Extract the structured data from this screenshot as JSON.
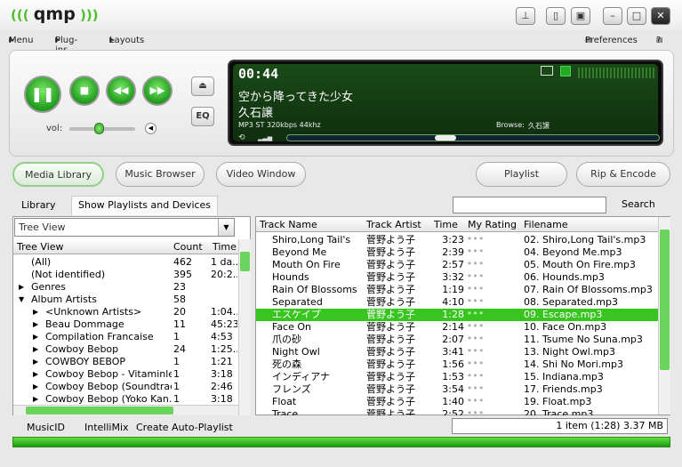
{
  "app": {
    "logo_text": "qmp"
  },
  "menu": {
    "menu": "Menu",
    "plugins": "Plug-ins",
    "layouts": "Layouts",
    "preferences": "Preferences",
    "help": "?"
  },
  "player": {
    "time": "00:44",
    "title": "空から降ってきた少女",
    "artist": "久石譲",
    "format": "MP3 ST 320kbps 44khz",
    "browse_label": "Browse:",
    "browse_value": "久石譲",
    "vol_label": "vol:",
    "eq_label": "EQ",
    "progress": 0.42,
    "volume": 0.45
  },
  "nav": {
    "media_library": "Media Library",
    "music_browser": "Music Browser",
    "video_window": "Video Window",
    "playlist": "Playlist",
    "rip_encode": "Rip & Encode"
  },
  "tabs": {
    "library": "Library",
    "show_playlists": "Show Playlists and Devices",
    "search_button": "Search",
    "search_value": ""
  },
  "tree": {
    "view_select": "Tree View",
    "headers": {
      "name": "Tree View",
      "count": "Count",
      "time": "Time"
    },
    "rows": [
      {
        "name": "(All)",
        "count": "462",
        "time": "1 da..."
      },
      {
        "name": "(Not identified)",
        "count": "395",
        "time": "20:2..."
      },
      {
        "name": "Genres",
        "count": "23",
        "time": ""
      },
      {
        "name": "Album Artists",
        "count": "58",
        "time": ""
      },
      {
        "name": "<Unknown Artists>",
        "count": "20",
        "time": "1:04..."
      },
      {
        "name": "Beau Dommage",
        "count": "11",
        "time": "45:23"
      },
      {
        "name": "Compilation Francaise",
        "count": "1",
        "time": "4:53"
      },
      {
        "name": "Cowboy Bebop",
        "count": "24",
        "time": "1:25..."
      },
      {
        "name": "COWBOY BEBOP",
        "count": "1",
        "time": "1:21"
      },
      {
        "name": "Cowboy Bebop - Vitaminless",
        "count": "1",
        "time": "3:18"
      },
      {
        "name": "Cowboy Bebop (Soundtrack)",
        "count": "1",
        "time": "2:46"
      },
      {
        "name": "Cowboy Bebop (Yoko Kan...",
        "count": "1",
        "time": "3:18"
      }
    ]
  },
  "tracks": {
    "headers": {
      "name": "Track Name",
      "artist": "Track Artist",
      "time": "Time",
      "rating": "My Rating",
      "file": "Filename"
    },
    "rows": [
      {
        "name": "Shiro,Long Tail's",
        "artist": "菅野よう子",
        "time": "3:23",
        "rating": "* * *",
        "file": "02. Shiro,Long Tail's.mp3"
      },
      {
        "name": "Beyond Me",
        "artist": "菅野よう子",
        "time": "2:39",
        "rating": "* * *",
        "file": "04. Beyond Me.mp3"
      },
      {
        "name": "Mouth On Fire",
        "artist": "菅野よう子",
        "time": "2:57",
        "rating": "* * *",
        "file": "05. Mouth On Fire.mp3"
      },
      {
        "name": "Hounds",
        "artist": "菅野よう子",
        "time": "3:32",
        "rating": "* * *",
        "file": "06. Hounds.mp3"
      },
      {
        "name": "Rain Of Blossoms",
        "artist": "菅野よう子",
        "time": "1:19",
        "rating": "* * *",
        "file": "07. Rain Of Blossoms.mp3"
      },
      {
        "name": "Separated",
        "artist": "菅野よう子",
        "time": "4:10",
        "rating": "* * *",
        "file": "08. Separated.mp3"
      },
      {
        "name": "エスケイプ",
        "artist": "菅野よう子",
        "time": "1:28",
        "rating": "* * *",
        "file": "09. Escape.mp3"
      },
      {
        "name": "Face On",
        "artist": "菅野よう子",
        "time": "2:14",
        "rating": "* * *",
        "file": "10. Face On.mp3"
      },
      {
        "name": "爪の砂",
        "artist": "菅野よう子",
        "time": "2:07",
        "rating": "* * *",
        "file": "11. Tsume No Suna.mp3"
      },
      {
        "name": "Night Owl",
        "artist": "菅野よう子",
        "time": "3:41",
        "rating": "* * *",
        "file": "13. Night Owl.mp3"
      },
      {
        "name": "死の森",
        "artist": "菅野よう子",
        "time": "1:56",
        "rating": "* * *",
        "file": "14. Shi No Mori.mp3"
      },
      {
        "name": "インディアナ",
        "artist": "菅野よう子",
        "time": "1:53",
        "rating": "* * *",
        "file": "15. Indiana.mp3"
      },
      {
        "name": "フレンズ",
        "artist": "菅野よう子",
        "time": "3:54",
        "rating": "* * *",
        "file": "17. Friends.mp3"
      },
      {
        "name": "Float",
        "artist": "菅野よう子",
        "time": "1:40",
        "rating": "* * *",
        "file": "19. Float.mp3"
      },
      {
        "name": "Trace",
        "artist": "菅野よう子",
        "time": "2:52",
        "rating": "* * *",
        "file": "20. Trace.mp3"
      }
    ],
    "selected_index": 6
  },
  "bottom": {
    "music_id": "MusicID",
    "intellimix": "IntelliMix",
    "auto_playlist": "Create Auto-Playlist",
    "status": "1 item (1:28) 3.37 MB"
  },
  "colors": {
    "accent": "#38c51f",
    "display_bg": "#0f2e0e",
    "display_text": "#ffffff"
  },
  "icons": [
    "minimize-to-tray-icon",
    "mini-mode-icon",
    "skin-mode-icon",
    "minimize-icon",
    "maximize-icon",
    "close-icon",
    "play-pause-icon",
    "stop-icon",
    "rewind-icon",
    "fast-forward-icon",
    "eject-icon",
    "video-icon",
    "visualizer-icon",
    "repeat-icon",
    "signal-icon",
    "mute-icon",
    "play-track-icon",
    "expand-icon"
  ]
}
